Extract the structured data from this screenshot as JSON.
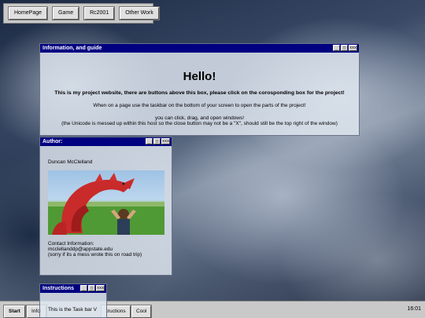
{
  "top_nav": {
    "buttons": [
      "HomePage",
      "Game",
      "Rc2001",
      "Other Work"
    ]
  },
  "window_controls": {
    "minimize": "_",
    "maximize": "□",
    "close": "xxx"
  },
  "info_window": {
    "title": "Information, and guide",
    "heading": "Hello!",
    "intro": "This is my project website, there are buttons above this box, please click on the corosponding box for the project!",
    "taskbar_hint": "When on a page use the taskbar on the bottom of your screen to open the parts of the project!",
    "line_drag": "you can click, drag, and open windows!",
    "line_unicode": "(the Unicode is messed up within this host so the close button may not be a \"X\", should still be the top right of the window)"
  },
  "author_window": {
    "title": "Author:",
    "name": "Duncan McClelland",
    "contact_label": "Contact Information:",
    "email": "mcclellanddp@appstate.edu",
    "note": "(sorry if its a mess wrote this on road trip)"
  },
  "instructions_window": {
    "title": "Instructions",
    "text": "This is the Task bar V"
  },
  "taskbar": {
    "start": "Start",
    "items": [
      "Infor",
      "tructions",
      "Cool"
    ],
    "clock": "16:01"
  }
}
